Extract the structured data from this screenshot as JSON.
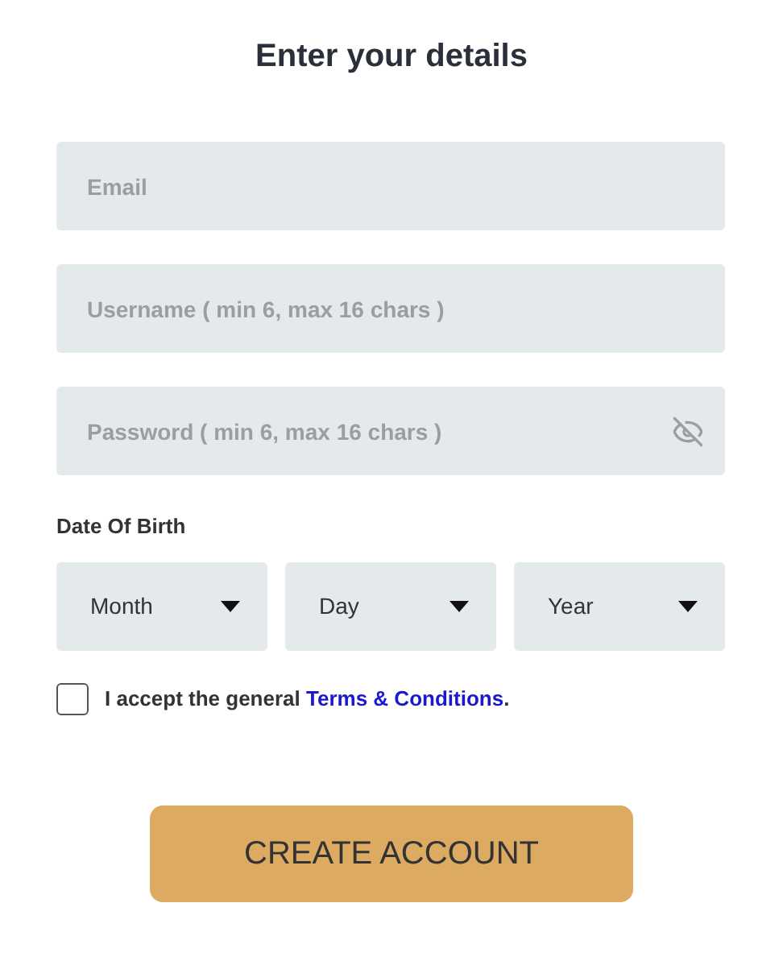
{
  "title": "Enter your details",
  "fields": [
    {
      "placeholder": "Email",
      "kind": "text"
    },
    {
      "placeholder": "Username ( min 6, max 16 chars )",
      "kind": "text"
    },
    {
      "placeholder": "Password ( min 6, max 16 chars )",
      "kind": "password"
    }
  ],
  "dob": {
    "label": "Date Of Birth",
    "selects": [
      "Month",
      "Day",
      "Year"
    ]
  },
  "terms": {
    "checked": false,
    "text": "I accept the general",
    "link": "Terms & Conditions",
    "end": "."
  },
  "button": "CREATE ACCOUNT"
}
